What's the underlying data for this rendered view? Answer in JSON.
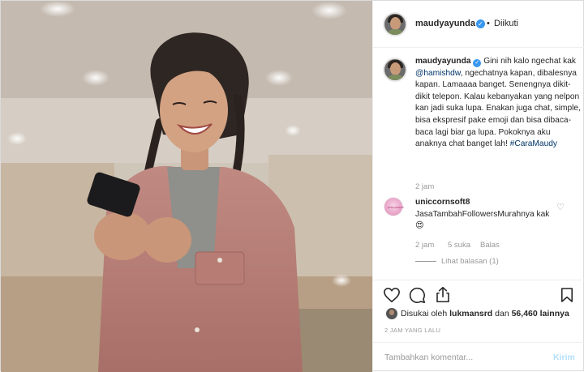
{
  "header": {
    "username": "maudyayunda",
    "verified_mark": "✓",
    "separator": "•",
    "follow_status": "Diikuti"
  },
  "caption": {
    "username": "maudyayunda",
    "verified_mark": "✓",
    "text_before": " Gini nih kalo ngechat kak ",
    "mention": "@hamishdw",
    "text_after": ", ngechatnya kapan, dibalesnya kapan. Lamaaaa banget. Senengnya dikit-dikit telepon. Kalau kebanyakan yang nelpon kan jadi suka lupa. Enakan juga chat, simple, bisa ekspresif pake emoji dan bisa dibaca-baca lagi biar ga lupa. Pokoknya aku anaknya chat banget lah! ",
    "hashtag": "#CaraMaudy",
    "time": "2 jam"
  },
  "comment": {
    "username": "uniccornsoft8",
    "avatar_text": "unicornsoft",
    "text": "JasaTambahFollowersMurahnya kak ",
    "emoji": "😍",
    "time": "2 jam",
    "likes": "5 suka",
    "reply": "Balas",
    "view_replies": "Lihat balasan (1)",
    "heart_icon": "♡"
  },
  "likes": {
    "prefix": "Disukai oleh ",
    "user": "lukmansrd",
    "middle": " dan ",
    "count": "56,460 lainnya"
  },
  "timestamp": "2 JAM YANG LALU",
  "add_comment": {
    "placeholder": "Tambahkan komentar...",
    "post_label": "Kirim"
  },
  "colors": {
    "verified": "#3897f0",
    "link": "#003569",
    "muted": "#999999",
    "post_disabled": "#b2dffc"
  },
  "icons": [
    "heart-icon",
    "comment-icon",
    "share-icon",
    "bookmark-icon"
  ]
}
